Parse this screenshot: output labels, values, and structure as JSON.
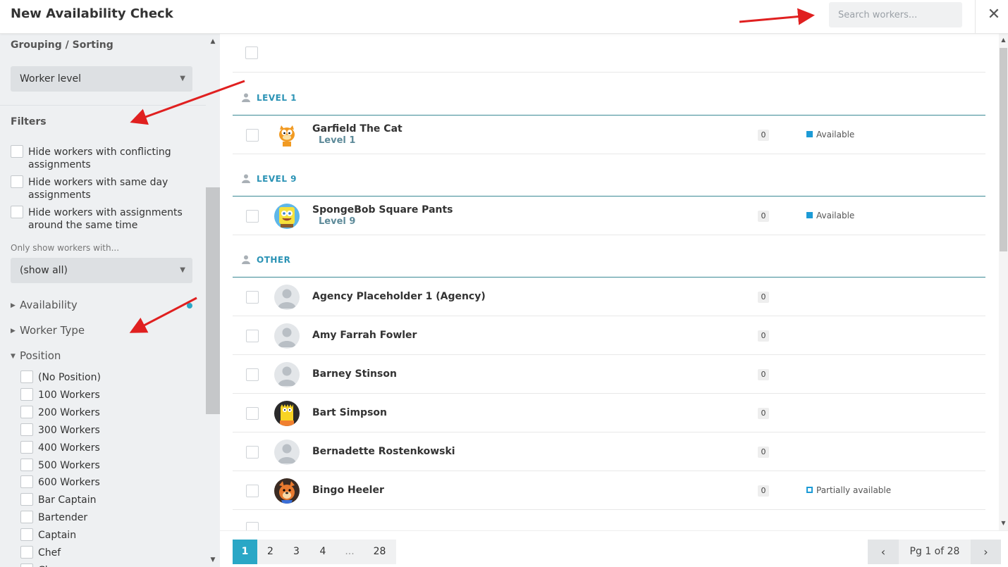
{
  "header": {
    "title": "New Availability Check",
    "search_placeholder": "Search workers...",
    "close_glyph": "✕"
  },
  "sidebar": {
    "grouping_title": "Grouping / Sorting",
    "grouping_value": "Worker level",
    "filters_title": "Filters",
    "filter_options": [
      "Hide workers with conflicting assignments",
      "Hide workers with same day assignments",
      "Hide workers with assignments around the same time"
    ],
    "only_show_label": "Only show workers with...",
    "only_show_value": "(show all)",
    "sections": [
      {
        "label": "Availability",
        "expanded": false
      },
      {
        "label": "Worker Type",
        "expanded": false
      },
      {
        "label": "Position",
        "expanded": true
      }
    ],
    "positions": [
      "(No Position)",
      "100 Workers",
      "200 Workers",
      "300 Workers",
      "400 Workers",
      "500 Workers",
      "600 Workers",
      "Bar Captain",
      "Bartender",
      "Captain",
      "Chef",
      "Cl..."
    ]
  },
  "groups": [
    {
      "label": "LEVEL 1",
      "workers": [
        {
          "name": "Garfield The Cat",
          "level": "Level 1",
          "count": "0",
          "status": "Available",
          "avatar": "garfield"
        }
      ]
    },
    {
      "label": "LEVEL 9",
      "workers": [
        {
          "name": "SpongeBob Square Pants",
          "level": "Level 9",
          "count": "0",
          "status": "Available",
          "avatar": "spongebob"
        }
      ]
    },
    {
      "label": "OTHER",
      "workers": [
        {
          "name": "Agency Placeholder 1 (Agency)",
          "count": "0",
          "status": "",
          "avatar": "placeholder"
        },
        {
          "name": "Amy Farrah Fowler",
          "count": "0",
          "status": "",
          "avatar": "placeholder"
        },
        {
          "name": "Barney Stinson",
          "count": "0",
          "status": "",
          "avatar": "placeholder"
        },
        {
          "name": "Bart Simpson",
          "count": "0",
          "status": "",
          "avatar": "bart"
        },
        {
          "name": "Bernadette Rostenkowski",
          "count": "0",
          "status": "",
          "avatar": "placeholder"
        },
        {
          "name": "Bingo Heeler",
          "count": "0",
          "status": "Partially available",
          "avatar": "bingo"
        }
      ]
    }
  ],
  "colors": {
    "accent": "#2aa7c6",
    "available": "#1d9bd6",
    "group_line": "#3a8a95",
    "annotation_arrow": "#e02020"
  },
  "pagination": {
    "pages": [
      "1",
      "2",
      "3",
      "4",
      "...",
      "28"
    ],
    "current": "1",
    "label": "Pg 1 of 28",
    "prev_glyph": "‹",
    "next_glyph": "›"
  }
}
